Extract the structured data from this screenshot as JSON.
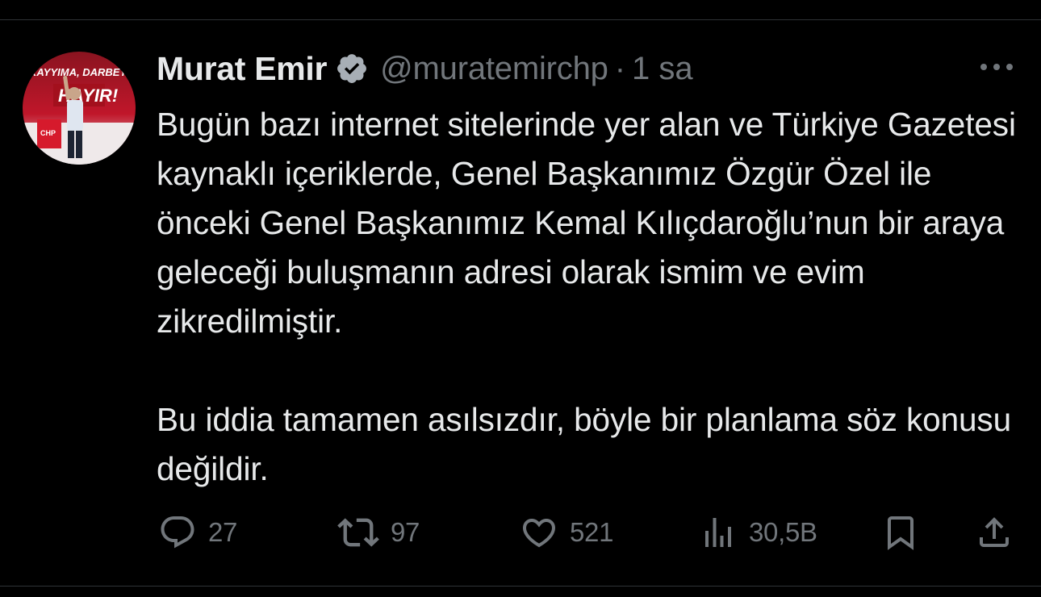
{
  "tweet": {
    "author": {
      "display_name": "Murat Emir",
      "handle": "@muratemirchp",
      "verified": true,
      "avatar_banner_text": "KAYYIMA, DARBEY",
      "avatar_sign_text": "HAYIR!",
      "avatar_podium_text": "CHP"
    },
    "separator": "·",
    "time": "1 sa",
    "paragraphs": [
      "Bugün bazı internet sitelerinde yer alan ve Türkiye Gazetesi kaynaklı içeriklerde, Genel Başkanımız Özgür Özel ile önceki Genel Başkanımız Kemal Kılıçdaroğlu’nun bir araya geleceği buluşmanın adresi olarak ismim ve evim zikredilmiştir.",
      "Bu iddia tamamen asılsızdır, böyle bir planlama söz konusu değildir."
    ],
    "actions": {
      "replies": "27",
      "reposts": "97",
      "likes": "521",
      "views": "30,5B"
    }
  },
  "colors": {
    "background": "#000000",
    "text_primary": "#e7e9ea",
    "text_secondary": "#71767b",
    "divider": "#2f3336",
    "verified_badge": "#a7aeb5"
  },
  "icons": {
    "more": "more-horizontal-icon",
    "reply": "reply-icon",
    "repost": "repost-icon",
    "like": "heart-icon",
    "views": "views-chart-icon",
    "bookmark": "bookmark-icon",
    "share": "share-icon",
    "verified": "verified-badge-icon"
  }
}
